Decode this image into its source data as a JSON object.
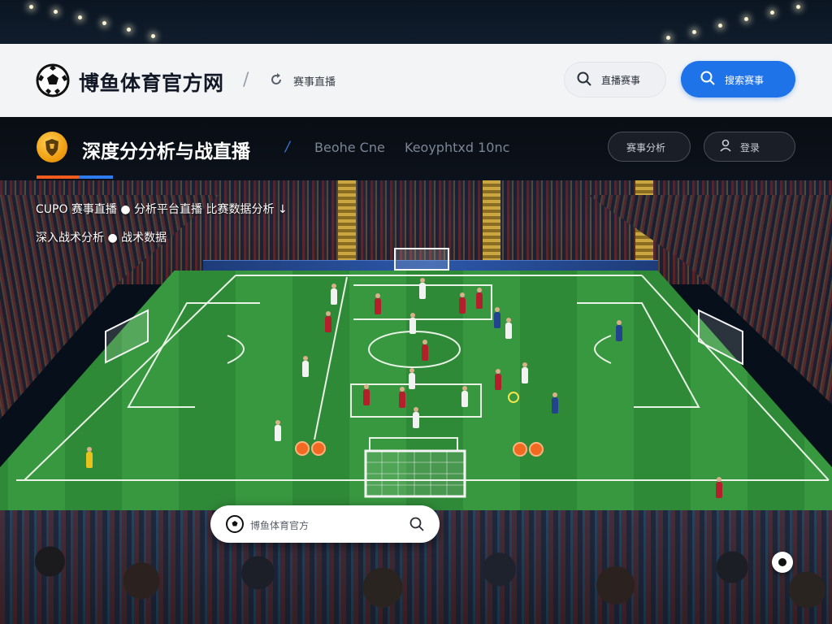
{
  "header": {
    "site_title": "博鱼体育官方网",
    "separator": "/",
    "nav_link": "赛事直播",
    "search_text": "直播赛事",
    "primary_button": "搜索赛事"
  },
  "hero": {
    "title": "深度分分析与战直播",
    "separator": "/",
    "subtitle_1": "Beohe Cne",
    "subtitle_2": "Keoyphtxd 10nc",
    "button_1": "赛事分析",
    "button_2": "登录"
  },
  "overlay": {
    "line_1": "CUPO 赛事直播 ● 分析平台直播 比赛数据分析 ↓",
    "line_2": "深入战术分析 ● 战术数据"
  },
  "bottom_search": {
    "placeholder": "博鱼体育官方"
  },
  "colors": {
    "accent_blue": "#1e73e8",
    "accent_orange": "#f25c1d",
    "hero_badge": "#f0a012",
    "header_bg": "#f3f4f6",
    "hero_bg": "#090d14"
  },
  "icons": {
    "logo": "soccer-ball-icon",
    "nav": "refresh-icon",
    "search": "search-icon",
    "user": "user-icon",
    "hero_badge": "shield-icon",
    "float": "record-icon"
  }
}
